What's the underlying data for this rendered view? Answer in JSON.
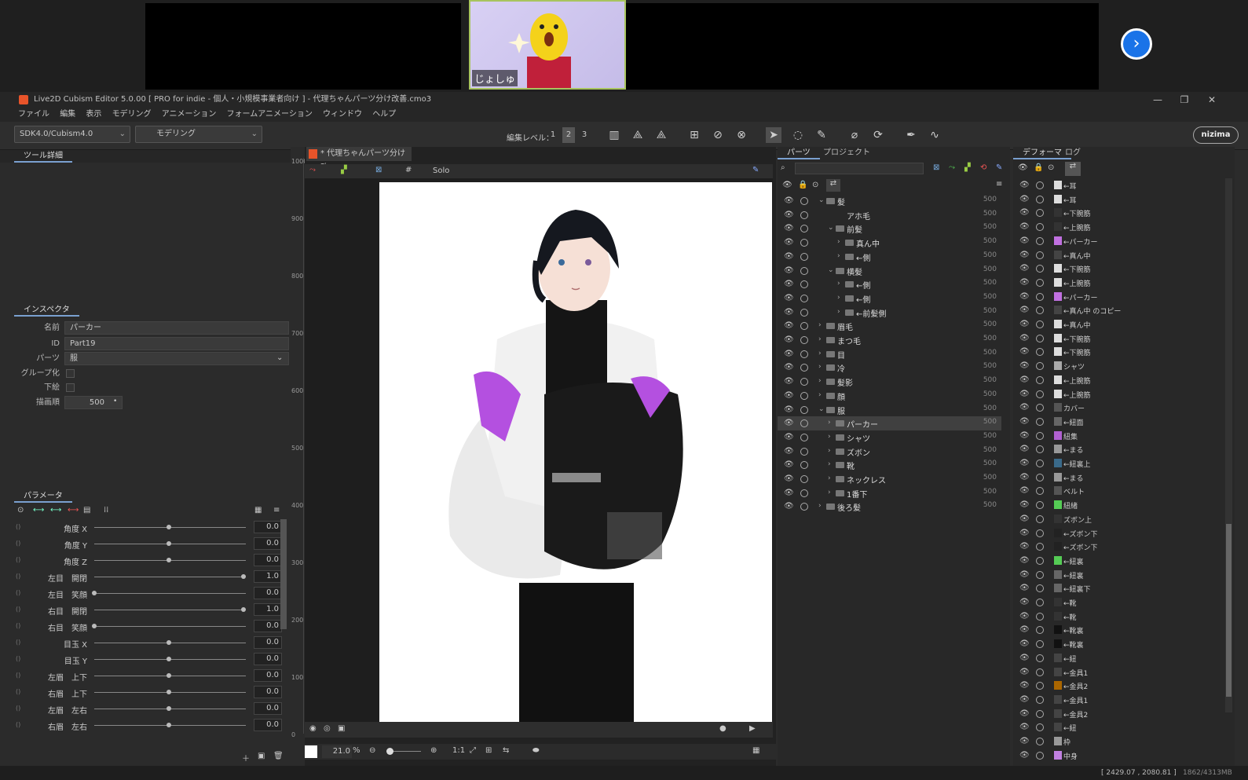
{
  "call": {
    "participant_name": "じょしゅ"
  },
  "app": {
    "title": "Live2D Cubism Editor 5.0.00 [ PRO for indie - 個人・小規模事業者向け ] - 代理ちゃんパーツ分け改善.cmo3",
    "menu": [
      "ファイル",
      "編集",
      "表示",
      "モデリング",
      "アニメーション",
      "フォームアニメーション",
      "ウィンドウ",
      "ヘルプ"
    ],
    "sdk_select": "SDK4.0/Cubism4.0",
    "mode_select": "モデリング",
    "edit_level_label": "編集レベル：",
    "edit_levels": [
      "1",
      "2",
      "3"
    ],
    "nizima": "nizima"
  },
  "tool_detail": {
    "title": "ツール詳細"
  },
  "inspector": {
    "title": "インスペクタ",
    "name_label": "名前",
    "name_value": "パーカー",
    "id_label": "ID",
    "id_value": "Part19",
    "part_label": "パーツ",
    "part_value": "服",
    "group_label": "グループ化",
    "clip_label": "下絵",
    "draw_order_label": "描画順",
    "draw_order_value": "500"
  },
  "parameters": {
    "title": "パラメータ",
    "items": [
      {
        "label": "角度 X",
        "value": "0.0",
        "pos": 0.5
      },
      {
        "label": "角度 Y",
        "value": "0.0",
        "pos": 0.5
      },
      {
        "label": "角度 Z",
        "value": "0.0",
        "pos": 0.5
      },
      {
        "label": "左目　開閉",
        "value": "1.0",
        "pos": 1.0
      },
      {
        "label": "左目　笑顔",
        "value": "0.0",
        "pos": 0.0
      },
      {
        "label": "右目　開閉",
        "value": "1.0",
        "pos": 1.0
      },
      {
        "label": "右目　笑顔",
        "value": "0.0",
        "pos": 0.0
      },
      {
        "label": "目玉 X",
        "value": "0.0",
        "pos": 0.5
      },
      {
        "label": "目玉 Y",
        "value": "0.0",
        "pos": 0.5
      },
      {
        "label": "左眉　上下",
        "value": "0.0",
        "pos": 0.5
      },
      {
        "label": "右眉　上下",
        "value": "0.0",
        "pos": 0.5
      },
      {
        "label": "左眉　左右",
        "value": "0.0",
        "pos": 0.5
      },
      {
        "label": "右眉　左右",
        "value": "0.0",
        "pos": 0.5
      }
    ]
  },
  "document": {
    "tab_title": "* 代理ちゃんパーツ分け改",
    "solo_label": "Solo",
    "zoom": "21.0",
    "zoom_unit": "%",
    "one_to_one": "1:1",
    "ruler": [
      "1000",
      "900",
      "800",
      "700",
      "600",
      "500",
      "400",
      "300",
      "200",
      "100",
      "0"
    ]
  },
  "parts_panel": {
    "tabs": [
      "パーツ",
      "プロジェクト"
    ],
    "rows": [
      {
        "name": "髪",
        "indent": 0,
        "open": true,
        "num": "500"
      },
      {
        "name": "アホ毛",
        "indent": 1,
        "leaf": true,
        "num": "500"
      },
      {
        "name": "前髪",
        "indent": 1,
        "open": true,
        "num": "500"
      },
      {
        "name": "真ん中",
        "indent": 2,
        "num": "500"
      },
      {
        "name": "←側",
        "indent": 2,
        "num": "500"
      },
      {
        "name": "横髪",
        "indent": 1,
        "open": true,
        "num": "500"
      },
      {
        "name": "←側",
        "indent": 2,
        "num": "500"
      },
      {
        "name": "←側",
        "indent": 2,
        "num": "500"
      },
      {
        "name": "←前髪側",
        "indent": 2,
        "num": "500"
      },
      {
        "name": "眉毛",
        "indent": 0,
        "num": "500"
      },
      {
        "name": "まつ毛",
        "indent": 0,
        "num": "500"
      },
      {
        "name": "目",
        "indent": 0,
        "num": "500"
      },
      {
        "name": "冷",
        "indent": 0,
        "num": "500"
      },
      {
        "name": "髪影",
        "indent": 0,
        "num": "500"
      },
      {
        "name": "顔",
        "indent": 0,
        "num": "500"
      },
      {
        "name": "服",
        "indent": 0,
        "open": true,
        "num": "500"
      },
      {
        "name": "パーカー",
        "indent": 1,
        "num": "500",
        "hl": true
      },
      {
        "name": "シャツ",
        "indent": 1,
        "num": "500"
      },
      {
        "name": "ズボン",
        "indent": 1,
        "num": "500"
      },
      {
        "name": "靴",
        "indent": 1,
        "num": "500"
      },
      {
        "name": "ネックレス",
        "indent": 1,
        "num": "500"
      },
      {
        "name": "1番下",
        "indent": 1,
        "num": "500"
      },
      {
        "name": "後ろ髪",
        "indent": 0,
        "num": "500"
      }
    ]
  },
  "deformer_panel": {
    "tabs": [
      "デフォーマ",
      "ログ"
    ],
    "rows": [
      "←耳",
      "←耳",
      "←下腕筋",
      "←上腕筋",
      "←パーカー",
      "←真ん中",
      "←下腕筋",
      "←上腕筋",
      "←パーカー",
      "←真ん中 のコピー",
      "←真ん中",
      "←下腕筋",
      "←下腕筋",
      "シャツ",
      "←上腕筋",
      "←上腕筋",
      "カバー",
      "←紐面",
      "紐集",
      "←まる",
      "←紐裏上",
      "←まる",
      "ベルト",
      "紐緒",
      "ズボン上",
      "←ズボン下",
      "←ズボン下",
      "←紐裏",
      "←紐裏",
      "←紐裏下",
      "←靴",
      "←靴",
      "←靴裏",
      "←靴裏",
      "←紐",
      "←金具1",
      "←金具2",
      "←金具1",
      "←金具2",
      "←紐",
      "枠",
      "中身"
    ]
  },
  "status": {
    "coords": "[ 2429.07 , 2080.81 ]",
    "mem": "1862/4313MB"
  }
}
